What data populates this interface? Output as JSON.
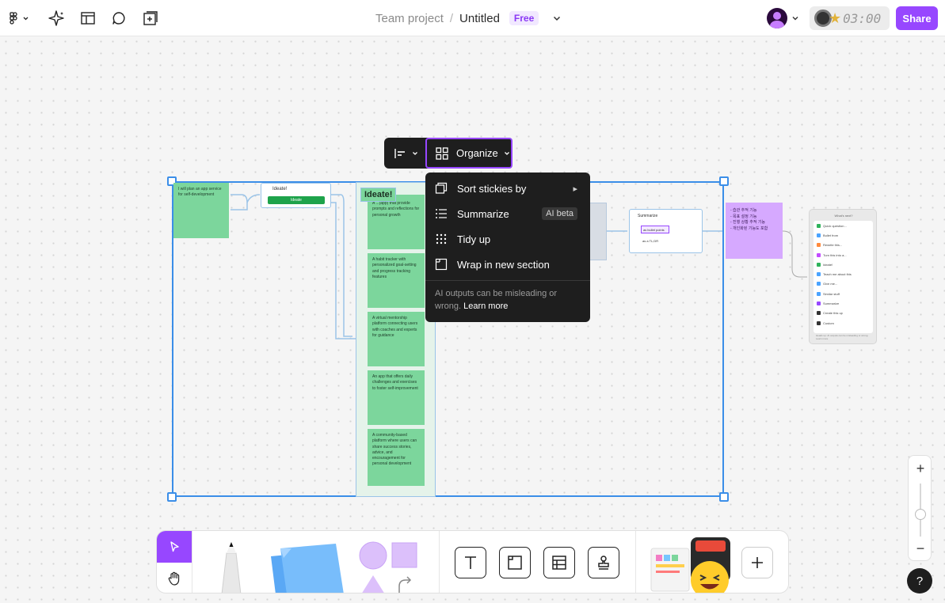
{
  "topbar": {
    "breadcrumb_team": "Team project",
    "breadcrumb_sep": "/",
    "file_title": "Untitled",
    "plan_badge": "Free",
    "timer": "03:00",
    "share_label": "Share"
  },
  "toolbar": {
    "organize_label": "Organize"
  },
  "organize_menu": {
    "items": [
      {
        "label": "Sort stickies by",
        "icon": "sort-stickies-icon"
      },
      {
        "label": "Summarize",
        "badge": "AI beta",
        "icon": "summarize-icon"
      },
      {
        "label": "Tidy up",
        "icon": "tidy-up-icon"
      },
      {
        "label": "Wrap in new section",
        "icon": "section-icon"
      }
    ],
    "note": "AI outputs can be misleading or wrong.",
    "note_link": "Learn more"
  },
  "canvas": {
    "first_sticky": "I will plan an app service for self-development",
    "ideate_card_title": "Ideate!",
    "ideate_card_button": "Ideate",
    "column_label": "Ideate!",
    "idea_stickies": [
      "A ...(app) that provide prompts and reflections for personal growth",
      "A habit tracker with personalized goal-setting and progress tracking features",
      "A virtual mentorship platform connecting users with coaches and experts for guidance",
      "An app that offers daily challenges and exercises to foster self-improvement",
      "A community-based platform where users can share success stories, advice, and encouragement for personal development"
    ],
    "summarize_card_title": "Summarize",
    "summarize_option_1": "as bullet points",
    "summarize_option_2": "as a TL;DR",
    "purple_sticky_lines": [
      "- 습관 추적 기능",
      "- 목표 설정 기능",
      "- 진행 상황 추적 기능",
      "- 개인화된 기능도 포함"
    ],
    "panel_title": "What's next?",
    "panel_items": [
      "Quick question...",
      "Bullet from",
      "Rewrite this...",
      "Turn this into a...",
      "Ideate!",
      "Teach me about this",
      "Give me...",
      "Similar stuff",
      "Summarize",
      "Create this up",
      "Custom"
    ],
    "panel_footer": "Heads up: AI outputs can be misleading or wrong. Learn more"
  },
  "zoom": {
    "plus": "+",
    "minus": "−"
  },
  "help_label": "?",
  "colors": {
    "accent": "#9747ff",
    "selection": "#3b8ee8",
    "sticky_green": "#7cd69c",
    "sticky_purple": "#d6a9ff",
    "menu_bg": "#1e1e1e"
  }
}
